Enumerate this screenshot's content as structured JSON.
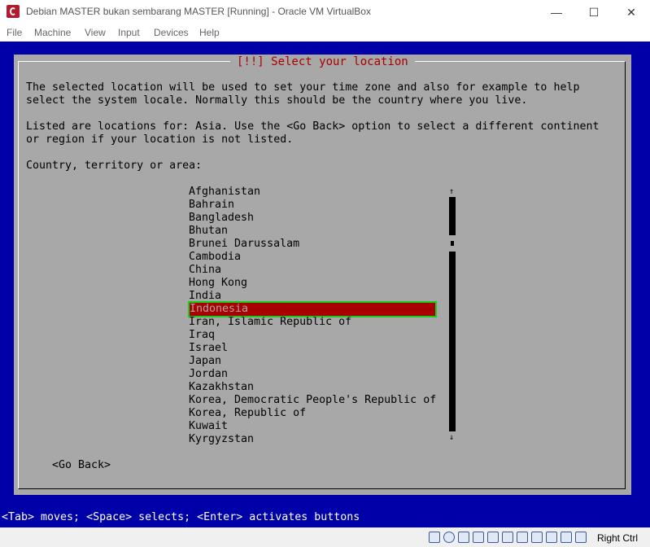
{
  "window": {
    "title": "Debian MASTER bukan sembarang MASTER [Running] - Oracle VM VirtualBox",
    "min_glyph": "—",
    "max_glyph": "☐",
    "close_glyph": "✕"
  },
  "menu": [
    "File",
    "Machine",
    "View",
    "Input",
    "Devices",
    "Help"
  ],
  "dialog": {
    "title": "[!!] Select your location",
    "para1_line1": "The selected location will be used to set your time zone and also for example to help",
    "para1_line2": "select the system locale. Normally this should be the country where you live.",
    "para2_line1": "Listed are locations for: Asia. Use the <Go Back> option to select a different continent",
    "para2_line2": "or region if your location is not listed.",
    "prompt": "Country, territory or area:",
    "items": [
      "Afghanistan",
      "Bahrain",
      "Bangladesh",
      "Bhutan",
      "Brunei Darussalam",
      "Cambodia",
      "China",
      "Hong Kong",
      "India",
      "Indonesia",
      "Iran, Islamic Republic of",
      "Iraq",
      "Israel",
      "Japan",
      "Jordan",
      "Kazakhstan",
      "Korea, Democratic People's Republic of",
      "Korea, Republic of",
      "Kuwait",
      "Kyrgyzstan"
    ],
    "selected_item": "Indonesia",
    "scroll_up": "↑",
    "scroll_down": "↓",
    "go_back": "<Go Back>"
  },
  "help_line": "<Tab> moves; <Space> selects; <Enter> activates buttons",
  "statusbar": {
    "host_key": "Right Ctrl",
    "icons": [
      "hard-disk-icon",
      "optical-disk-icon",
      "audio-icon",
      "network-icon",
      "usb-icon",
      "shared-folder-icon",
      "display-icon",
      "video-capture-icon",
      "cpu-icon",
      "mouse-icon",
      "keyboard-icon"
    ]
  },
  "colors": {
    "vm_background": "#0000a8",
    "dialog_background": "#a8a8a8",
    "title_red": "#a80000",
    "selection_bg": "#a80000",
    "selection_outline": "#18d018"
  }
}
